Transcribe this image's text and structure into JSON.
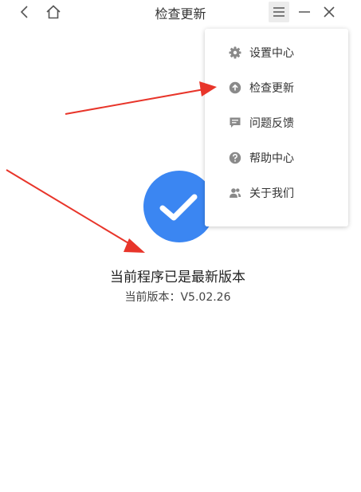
{
  "window": {
    "title": "检查更新",
    "controls": [
      "back-icon",
      "home-icon",
      "menu-icon",
      "minimize-icon",
      "close-icon"
    ]
  },
  "menu": {
    "items": [
      {
        "label": "设置中心",
        "icon": "gear-icon"
      },
      {
        "label": "检查更新",
        "icon": "upload-circle-icon"
      },
      {
        "label": "问题反馈",
        "icon": "feedback-icon"
      },
      {
        "label": "帮助中心",
        "icon": "help-circle-icon"
      },
      {
        "label": "关于我们",
        "icon": "users-icon"
      }
    ]
  },
  "status": {
    "title": "当前程序已是最新版本",
    "version": "当前版本：V5.02.26",
    "icon": "check-icon"
  },
  "colors": {
    "accent": "#3b86f2",
    "annotation_arrow": "#e8352a",
    "menu_icon": "#8a8a8a"
  }
}
